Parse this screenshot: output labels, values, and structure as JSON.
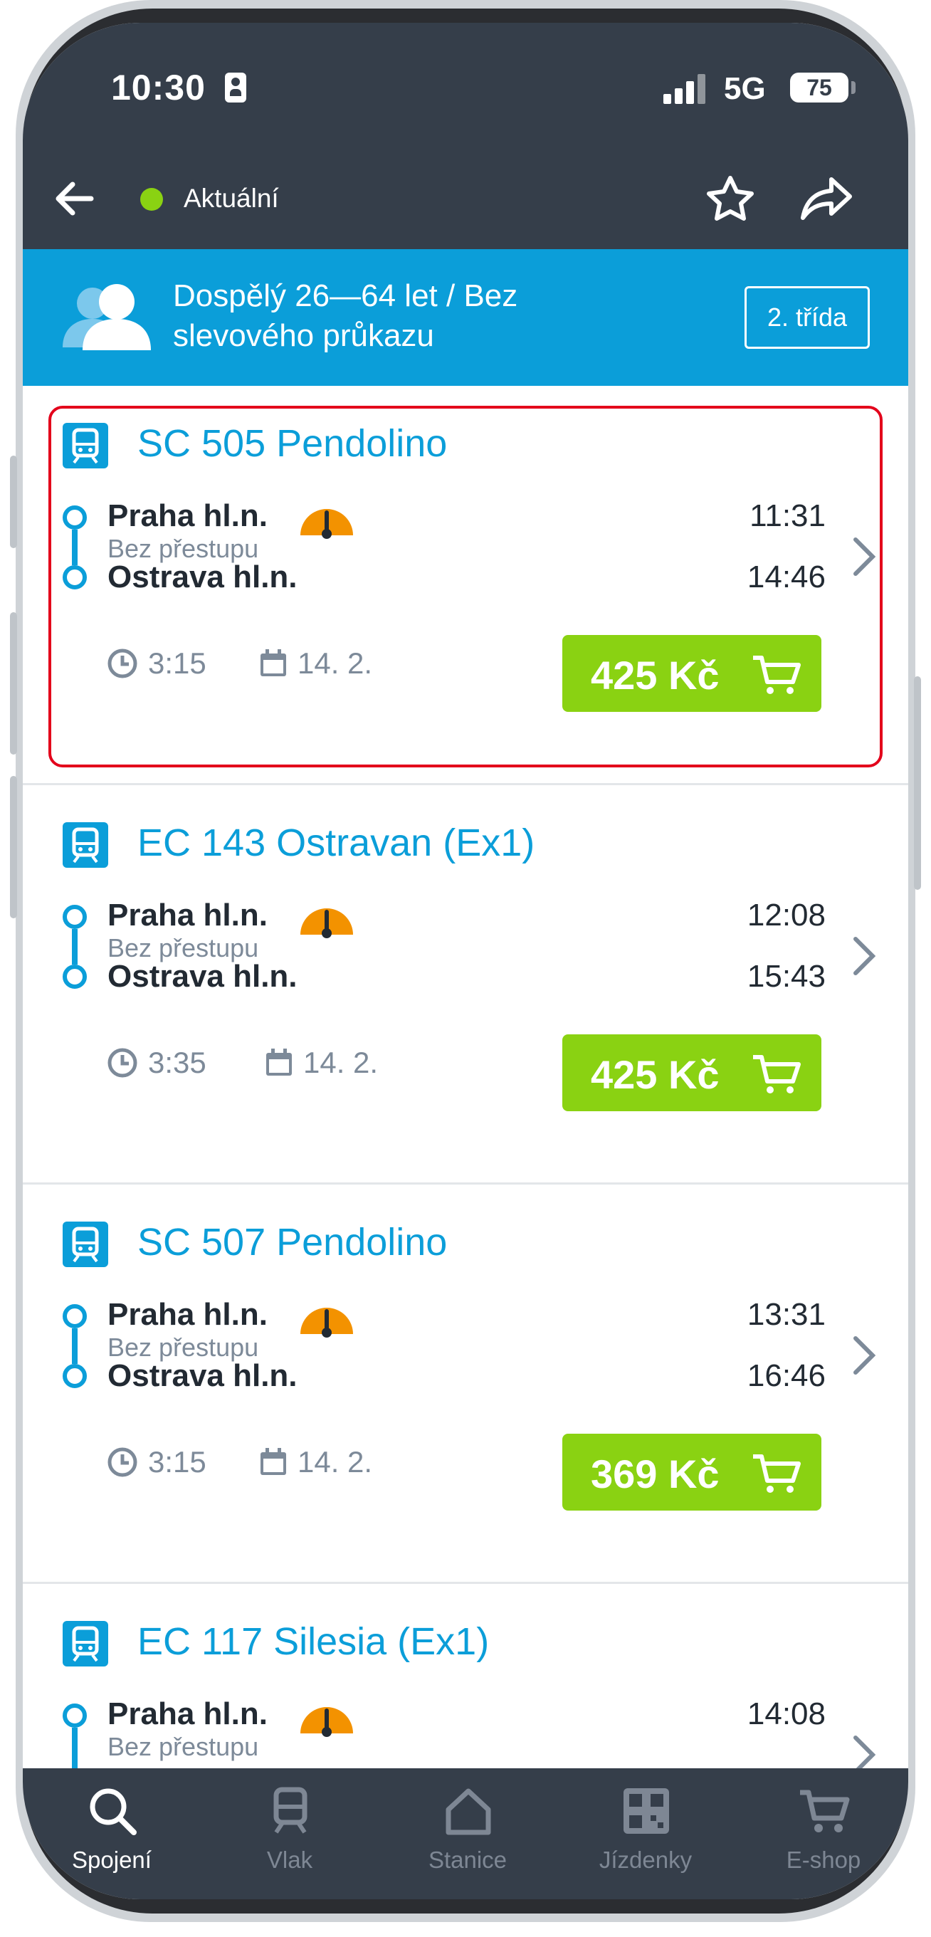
{
  "status_bar": {
    "time": "10:30",
    "network": "5G",
    "battery": "75"
  },
  "header": {
    "status_label": "Aktuální"
  },
  "passenger": {
    "description": "Dospělý 26—64 let / Bez slevového průkazu",
    "class_button": "2. třída"
  },
  "connections": [
    {
      "train": "SC 505 Pendolino",
      "from": "Praha hl.n.",
      "dep": "11:31",
      "transfer": "Bez přestupu",
      "to": "Ostrava hl.n.",
      "arr": "14:46",
      "duration": "3:15",
      "date": "14. 2.",
      "price": "425 Kč",
      "selected": true
    },
    {
      "train": "EC 143 Ostravan (Ex1)",
      "from": "Praha hl.n.",
      "dep": "12:08",
      "transfer": "Bez přestupu",
      "to": "Ostrava hl.n.",
      "arr": "15:43",
      "duration": "3:35",
      "date": "14. 2.",
      "price": "425 Kč",
      "selected": false
    },
    {
      "train": "SC 507 Pendolino",
      "from": "Praha hl.n.",
      "dep": "13:31",
      "transfer": "Bez přestupu",
      "to": "Ostrava hl.n.",
      "arr": "16:46",
      "duration": "3:15",
      "date": "14. 2.",
      "price": "369 Kč",
      "selected": false
    },
    {
      "train": "EC 117 Silesia (Ex1)",
      "from": "Praha hl.n.",
      "dep": "14:08",
      "transfer": "Bez přestupu"
    }
  ],
  "tabs": [
    {
      "label": "Spojení",
      "icon": "search-icon",
      "active": true
    },
    {
      "label": "Vlak",
      "icon": "train-icon",
      "active": false
    },
    {
      "label": "Stanice",
      "icon": "house-icon",
      "active": false
    },
    {
      "label": "Jízdenky",
      "icon": "qr-code-icon",
      "active": false
    },
    {
      "label": "E-shop",
      "icon": "cart-icon",
      "active": false
    }
  ],
  "colors": {
    "accent": "#0b9ed9",
    "price": "#8ad212",
    "header": "#353e4a",
    "online": "#8ad212",
    "selection": "#e3001b",
    "gauge": "#f39200"
  }
}
